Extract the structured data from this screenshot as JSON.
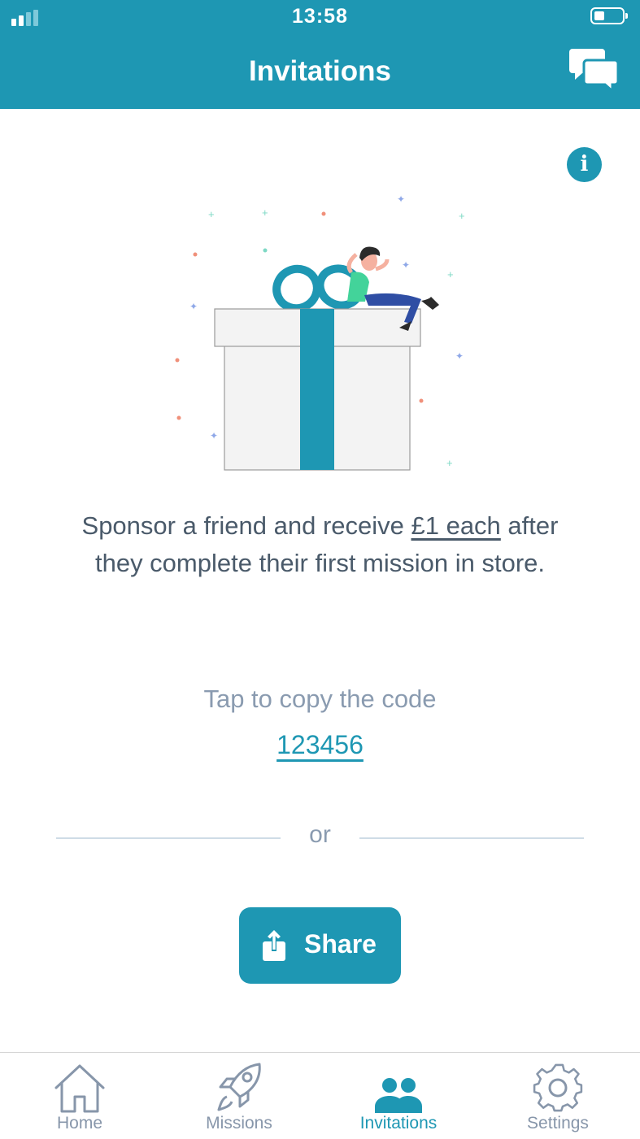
{
  "status_bar": {
    "time": "13:58"
  },
  "header": {
    "title": "Invitations"
  },
  "description": {
    "part1": "Sponsor a friend and receive ",
    "highlight": "£1 each",
    "part2": " after they complete their first mission in store."
  },
  "copy_hint": "Tap to copy the code",
  "code": "123456",
  "divider_text": "or",
  "share_label": "Share",
  "tabs": [
    {
      "label": "Home",
      "icon": "home-icon",
      "active": false
    },
    {
      "label": "Missions",
      "icon": "rocket-icon",
      "active": false
    },
    {
      "label": "Invitations",
      "icon": "people-icon",
      "active": true
    },
    {
      "label": "Settings",
      "icon": "gear-icon",
      "active": false
    }
  ],
  "colors": {
    "primary": "#1e97b3",
    "text_dark": "#4a5a6a",
    "text_muted": "#8a9bb0",
    "tab_inactive": "#8796aa"
  }
}
